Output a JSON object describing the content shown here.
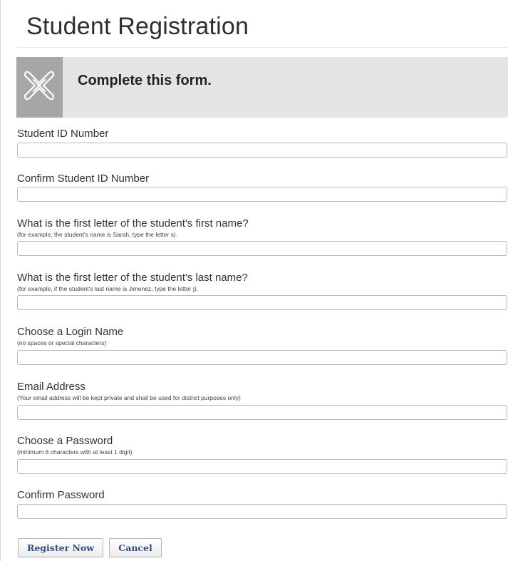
{
  "page": {
    "title": "Student Registration"
  },
  "banner": {
    "text": "Complete this form.",
    "logo_icon": "knot-logo-icon",
    "colors": {
      "banner_bg": "#e4e4e4",
      "logo_bg": "#a6a6a6"
    }
  },
  "form": {
    "fields": [
      {
        "label": "Student ID Number",
        "hint": "",
        "value": ""
      },
      {
        "label": "Confirm Student ID Number",
        "hint": "",
        "value": ""
      },
      {
        "label": "What is the first letter of the student's first name?",
        "hint": "(for example, the student's name is Sarah, type the letter s).",
        "value": ""
      },
      {
        "label": "What is the first letter of the student's last name?",
        "hint": "(for example, if the student's last name is Jimenez, type the letter j).",
        "value": ""
      },
      {
        "label": "Choose a Login Name",
        "hint": "(no spaces or special characters)",
        "value": ""
      },
      {
        "label": "Email Address",
        "hint": "(Your email address will be kept private and shall be used for district purposes only)",
        "value": ""
      },
      {
        "label": "Choose a Password",
        "hint": "(minimum 6 characters with at least 1 digit)",
        "value": ""
      },
      {
        "label": "Confirm Password",
        "hint": "",
        "value": ""
      }
    ]
  },
  "buttons": {
    "register_label": "Register Now",
    "cancel_label": "Cancel",
    "text_color": "#2e4f86"
  }
}
